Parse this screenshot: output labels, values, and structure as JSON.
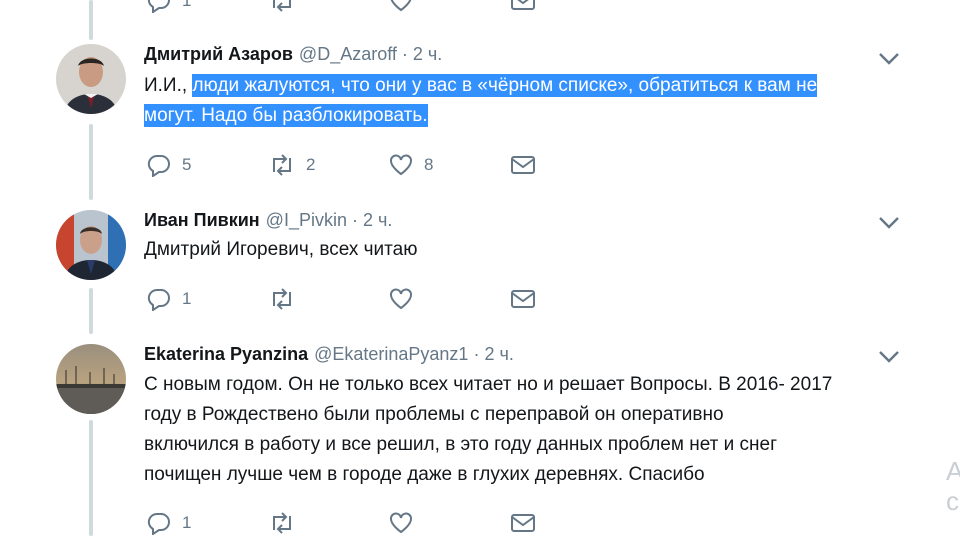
{
  "top_partial": {
    "reply_count": "1"
  },
  "tweets": [
    {
      "name": "Дмитрий Азаров",
      "handle": "@D_Azaroff",
      "time": "2 ч.",
      "text_prefix": "И.И., ",
      "text_selected_1": "люди жалуются, что они у вас в «чёрном списке», обратиться к вам не",
      "text_selected_2": "могут. Надо бы разблокировать.",
      "replies": "5",
      "retweets": "2",
      "likes": "8"
    },
    {
      "name": "Иван Пивкин",
      "handle": "@I_Pivkin",
      "time": "2 ч.",
      "text": "Дмитрий Игоревич, всех читаю",
      "replies": "1",
      "retweets": "",
      "likes": ""
    },
    {
      "name": "Ekaterina Pyanzina",
      "handle": "@EkaterinaPyanz1",
      "time": "2 ч.",
      "text_lines": [
        "С новым годом. Он не только всех читает но и решает Вопросы. В 2016- 2017",
        "году в Рождествено были проблемы с переправой он оперативно",
        "включился в работу и все решил, в это году данных проблем нет и снег",
        "почищен лучше чем в городе даже в глухих деревнях. Спасибо"
      ],
      "replies": "1",
      "retweets": "",
      "likes": ""
    }
  ],
  "side_cut_text": [
    "А",
    "с"
  ],
  "colors": {
    "selection": "#3390ff",
    "thread_line": "#cfd9de",
    "muted": "#657786",
    "text": "#14171a"
  },
  "icons": [
    "reply-icon",
    "retweet-icon",
    "like-icon",
    "message-icon",
    "chevron-down-icon"
  ]
}
